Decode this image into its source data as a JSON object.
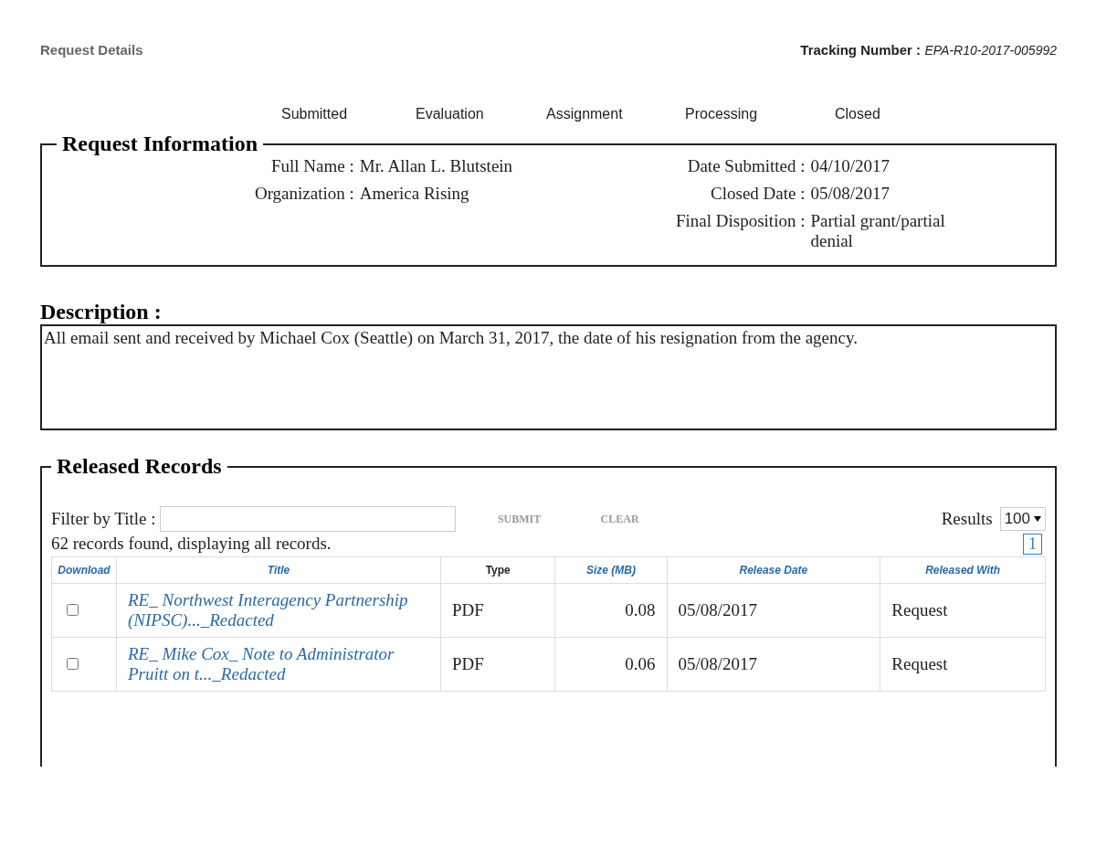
{
  "header": {
    "title": "Request Details",
    "tracking_label": "Tracking Number :",
    "tracking_number": "EPA-R10-2017-005992"
  },
  "steps": [
    "Submitted",
    "Evaluation",
    "Assignment",
    "Processing",
    "Closed"
  ],
  "request_information": {
    "legend": "Request Information",
    "left": [
      {
        "label": "Full Name :",
        "value": "Mr.  Allan L. Blutstein"
      },
      {
        "label": "Organization :",
        "value": "America Rising"
      }
    ],
    "right": [
      {
        "label": "Date Submitted :",
        "value": "04/10/2017"
      },
      {
        "label": "Closed Date :",
        "value": "05/08/2017"
      },
      {
        "label": "Final Disposition :",
        "value": "Partial grant/partial denial"
      }
    ]
  },
  "description": {
    "heading": "Description :",
    "text": "All email sent and received by Michael Cox (Seattle) on March 31, 2017, the date of his resignation from the agency."
  },
  "released_records": {
    "legend": "Released Records",
    "filter_label": "Filter by Title :",
    "submit": "SUBMIT",
    "clear": "CLEAR",
    "results_label": "Results",
    "results_value": "100",
    "records_found": "62 records found, displaying all records.",
    "page": "1",
    "columns": [
      {
        "label": "Download",
        "sortable": true
      },
      {
        "label": "Title",
        "sortable": true
      },
      {
        "label": "Type",
        "sortable": false
      },
      {
        "label": "Size (MB)",
        "sortable": true
      },
      {
        "label": "Release Date",
        "sortable": true
      },
      {
        "label": "Released With",
        "sortable": true
      }
    ],
    "rows": [
      {
        "checked": false,
        "title": "RE_ Northwest Interagency Partnership (NIPSC)..._Redacted",
        "type": "PDF",
        "size": "0.08",
        "release_date": "05/08/2017",
        "released_with": "Request"
      },
      {
        "checked": false,
        "title": "RE_ Mike Cox_ Note to Administrator Pruitt on t..._Redacted",
        "type": "PDF",
        "size": "0.06",
        "release_date": "05/08/2017",
        "released_with": "Request"
      }
    ]
  }
}
